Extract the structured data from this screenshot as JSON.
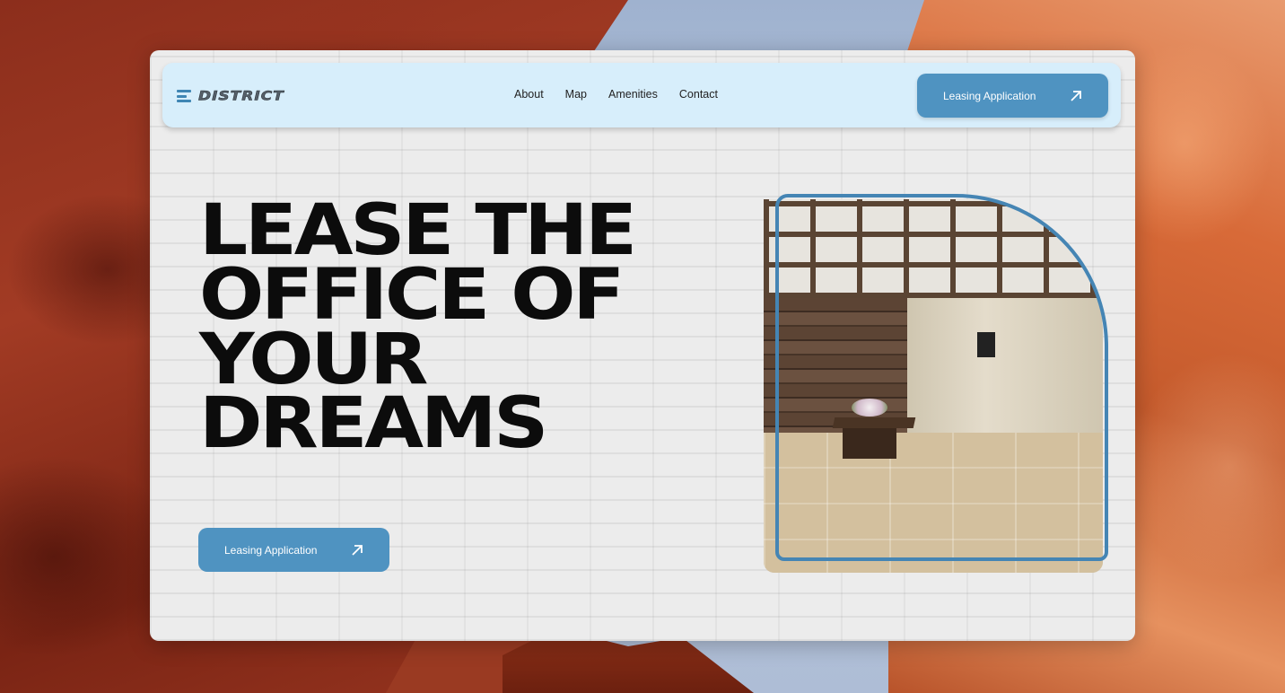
{
  "brand": {
    "name": "DISTRICT"
  },
  "nav": {
    "links": [
      "About",
      "Map",
      "Amenities",
      "Contact"
    ],
    "cta_label": "Leasing Application"
  },
  "hero": {
    "title": "LEASE THE\nOFFICE OF\nYOUR\nDREAMS",
    "cta_label": "Leasing Application"
  },
  "icons": {
    "cta_arrow": "arrow-up-right-icon",
    "logo": "district-logo-icon"
  },
  "colors": {
    "accent": "#4f93c1",
    "nav_bg": "#d7eefb",
    "frame": "#4585b4",
    "title": "#0c0c0c"
  }
}
